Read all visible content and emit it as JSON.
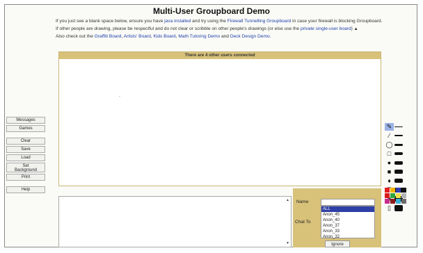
{
  "page": {
    "title": "Multi-User Groupboard Demo"
  },
  "intro": {
    "line1_prefix": "If you just see a blank space below, ensure you have ",
    "java_link": "java installed",
    "line1_middle": " and try using the ",
    "firewall_link": "Firewall Tunnelling Groupboard",
    "line1_suffix": " in case your firewall is blocking Groupboard.",
    "line2_prefix": "If other people are drawing, please be respectful and do not clear or scribble on other people's drawings (or else use the ",
    "private_link": "private single-user board",
    "line2_suffix": ")",
    "line3_prefix": "Also check out the ",
    "graffiti_link": "Graffiti Board",
    "comma1": ", ",
    "artists_link": "Artists' Board",
    "comma2": ", ",
    "kids_link": "Kids Board",
    "comma3": ", ",
    "math_link": "Math Tutoring Demo",
    "and": " and ",
    "deck_link": "Deck Design Demo",
    "period": "."
  },
  "board": {
    "status": "There are 4 other users connected"
  },
  "left_buttons": {
    "messages": "Messages",
    "games": "Games",
    "clear": "Clear",
    "save": "Save",
    "load": "Load",
    "set_background_1": "Set",
    "set_background_2": "Background",
    "print": "Print",
    "help": "Help"
  },
  "tools": {
    "icons": [
      "pencil-icon",
      "line-icon",
      "oval-icon",
      "rectangle-icon",
      "filled-oval-icon",
      "filled-rectangle-icon",
      "fill-icon",
      "text-icon",
      "eraser-icon",
      "trash-icon"
    ],
    "selected": "pencil-icon"
  },
  "palette": {
    "colors": [
      "#e21f1f",
      "#f3b400",
      "#2f3fb0",
      "#111111",
      "#d81c1c",
      "#2ea63b",
      "#f0e14a",
      "#b4b4b4",
      "#c62b8c",
      "#8c1a1a",
      "#3ab0d9",
      "#6b6b6b"
    ]
  },
  "chat": {
    "name_label": "Name",
    "chat_to_label": "Chat To",
    "recipients": [
      "ALL",
      "Anon_45",
      "Anon_40",
      "Anon_37",
      "Anon_33",
      "Anon_32"
    ],
    "selected_recipient": "ALL",
    "ignore_button": "Ignore"
  }
}
